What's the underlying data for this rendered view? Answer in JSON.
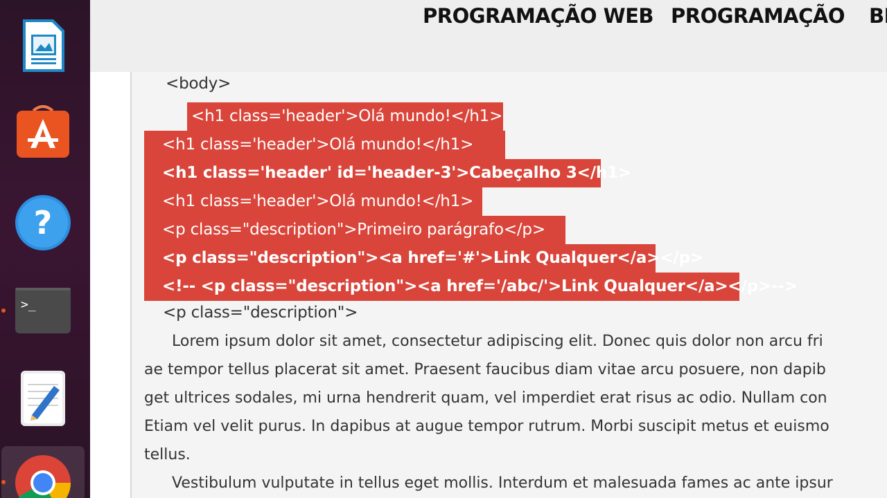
{
  "dock": {
    "items": [
      {
        "name": "libreoffice-impress"
      },
      {
        "name": "ubuntu-software"
      },
      {
        "name": "help"
      },
      {
        "name": "terminal",
        "prompt": ">_"
      },
      {
        "name": "text-editor"
      },
      {
        "name": "chrome"
      }
    ]
  },
  "nav": {
    "items": [
      "PROGRAMAÇÃO WEB",
      "PROGRAMAÇÃO",
      "BI"
    ]
  },
  "code": {
    "body_open": "<body>",
    "hl1": "<h1 class='header'>Olá mundo!</h1>",
    "hl2": "<h1 class='header'>Olá mundo!</h1>",
    "hl3": "<h1 class='header' id='header-3'>Cabeçalho 3</h1>",
    "hl4": "<h1 class='header'>Olá mundo!</h1>",
    "hl5": "<p class=\"description\">Primeiro parágrafo</p>",
    "hl6": "<p class=\"description\"><a href='#'>Link Qualquer</a></p>",
    "hl7": "<!-- <p class=\"description\"><a href='/abc/'>Link Qualquer</a></p>-->",
    "p_open": "<p class=\"description\">",
    "para1": [
      "Lorem ipsum dolor sit amet, consectetur adipiscing elit. Donec quis dolor non arcu fri",
      "ae tempor tellus placerat sit amet. Praesent faucibus diam vitae arcu posuere, non dapib",
      "get ultrices sodales, mi urna hendrerit quam, vel imperdiet erat risus ac odio. Nullam con",
      "Etiam vel velit purus. In dapibus at augue tempor rutrum. Morbi suscipit metus et euismo",
      "tellus."
    ],
    "para2": "Vestibulum vulputate in tellus eget mollis. Interdum et malesuada fames ac ante ipsur"
  }
}
